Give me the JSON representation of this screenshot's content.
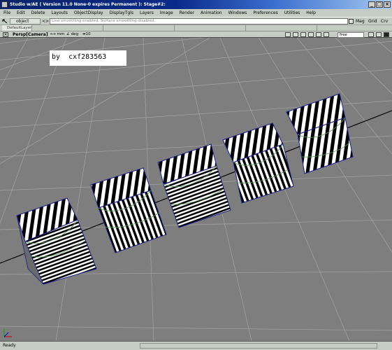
{
  "window": {
    "title": "Studio w/AE ( Version 11.0 None-0 expires Permanent ): Stage#2:",
    "minimize_glyph": "_",
    "maximize_glyph": "□",
    "close_glyph": "×"
  },
  "menus": [
    "File",
    "Edit",
    "Delete",
    "Layouts",
    "ObjectDisplay",
    "DisplayTgls",
    "Layers",
    "Image",
    "Render",
    "Animation",
    "Windows",
    "Preferences",
    "Utilities",
    "Help"
  ],
  "toolbar": {
    "mode_value": "object",
    "prompt_prefix": "<>",
    "prompt_text": "Line smoothing enabled. Surface smoothing disabled.",
    "mag_label": "Mag",
    "grid_label": "Grid",
    "crv_label": "Crv"
  },
  "layers": {
    "default_label": "DefaultLayer"
  },
  "viewport_header": {
    "close_glyph": "×",
    "title": "Persp[Camera]",
    "unit_mm": "mm",
    "unit_deg": "deg",
    "unit_ten": "10",
    "camera_field": "free"
  },
  "viewport": {
    "watermark": "by  cxf283563"
  },
  "statusbar": {
    "text": "Ready"
  },
  "colors": {
    "title_gradient_start": "#08246b",
    "title_gradient_end": "#a6caf0",
    "chrome": "#c5ccc4",
    "viewport_bg": "#7e7e7e",
    "grid_line": "#a4a4a4",
    "selection": "#1c1c8c",
    "curve_green": "#5a9e5a"
  },
  "icons": [
    "app-icon",
    "minimize-icon",
    "maximize-icon",
    "close-icon",
    "pick-tool-icon",
    "snap-icon",
    "viewport-close-icon",
    "layout-icons",
    "axis-triad-icon"
  ]
}
